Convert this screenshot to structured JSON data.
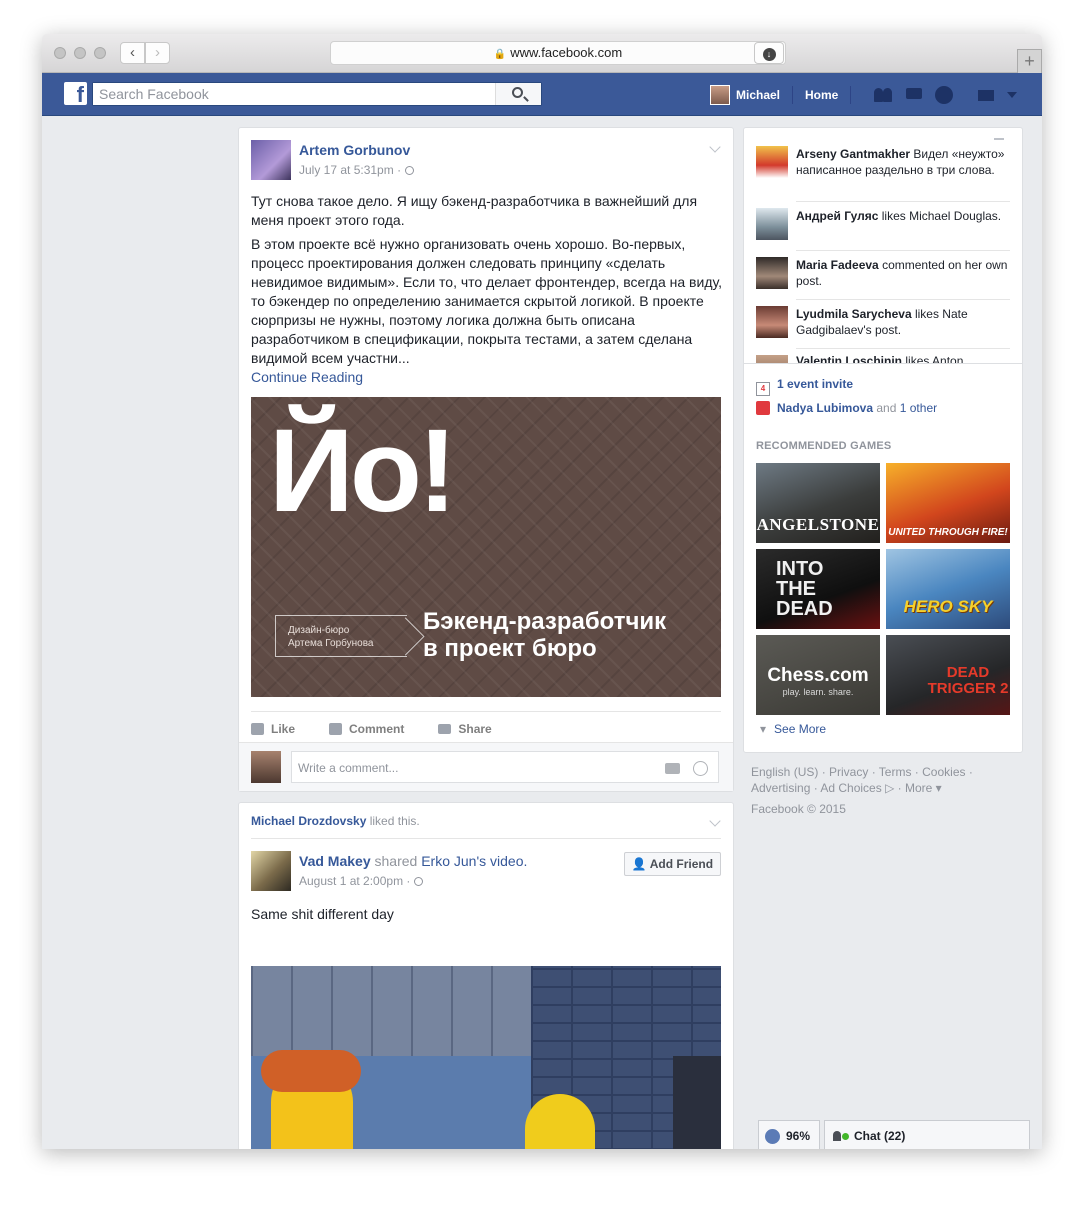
{
  "browser": {
    "url": "www.facebook.com",
    "back_icon": "‹",
    "forward_icon": "›",
    "reload_icon": "↻",
    "download_icon": "↓",
    "newtab_icon": "+"
  },
  "topbar": {
    "logo": "f",
    "search_placeholder": "Search Facebook",
    "user_name": "Michael",
    "home_label": "Home",
    "brand_color": "#3b5998"
  },
  "post1": {
    "author": "Artem Gorbunov",
    "date": "July 17 at 5:31pm",
    "paragraph1": "Тут снова такое дело. Я ищу бэкенд-разработчика в важнейший для меня проект этого года.",
    "paragraph2": "В этом проекте всё нужно организовать очень хорошо. Во-первых, процесс проектирования должен следовать принципу «сделать невидимое видимым». Если то, что делает фронтендер, всегда на виду, то бэкендер по определению занимается скрытой логикой. В проекте сюрпризы не нужны, поэтому логика должна быть описана разработчиком в спецификации, покрыта тестами, а затем сделана видимой всем участни...",
    "continue_label": "Continue Reading",
    "banner": {
      "headline": "Йо!",
      "studio_line1": "Дизайн-бюро",
      "studio_line2": "Артема Горбунова",
      "caption_line1": "Бэкенд-разработчик",
      "caption_line2": "в проект бюро"
    },
    "actions": [
      "Like",
      "Comment",
      "Share"
    ],
    "comment_placeholder": "Write a comment..."
  },
  "post2": {
    "liked_by": "Michael Drozdovsky",
    "liked_suffix": "liked this.",
    "author": "Vad Makey",
    "shared_word": "shared",
    "shared_target": "Erko Jun's",
    "shared_object": "video.",
    "date": "August 1 at 2:00pm",
    "add_friend": "Add Friend",
    "text": "Same shit different day"
  },
  "ticker": [
    {
      "name": "Arseny Gantmakher",
      "text": "Видел «неужто» написанное раздельно в три слова."
    },
    {
      "name": "Андрей Гуляс",
      "text": "likes Michael Douglas."
    },
    {
      "name": "Maria Fadeeva",
      "text": "commented on her own post."
    },
    {
      "name": "Lyudmila Sarycheva",
      "text": "likes Nate Gadgibalaev's post."
    },
    {
      "name": "Valentin Loschinin",
      "text": "likes Anton"
    }
  ],
  "events": {
    "invite": "1 event invite",
    "birthday_name": "Nadya Lubimova",
    "birthday_and": "and",
    "birthday_other": "1 other"
  },
  "games": {
    "title": "RECOMMENDED GAMES",
    "items": [
      "ANGELSTONE",
      "UNITED THROUGH FIRE!",
      "INTO THE DEAD",
      "HERO SKY",
      "Chess.com",
      "DEAD TRIGGER 2"
    ],
    "chess_tagline": "play. learn. share.",
    "see_more": "See More"
  },
  "footer": {
    "line1": "English (US) · Privacy · Terms · Cookies ·",
    "line2": "Advertising · Ad Choices ▷ · More ▾",
    "copyright": "Facebook © 2015"
  },
  "bottom": {
    "percent": "96%",
    "chat": "Chat (22)"
  }
}
